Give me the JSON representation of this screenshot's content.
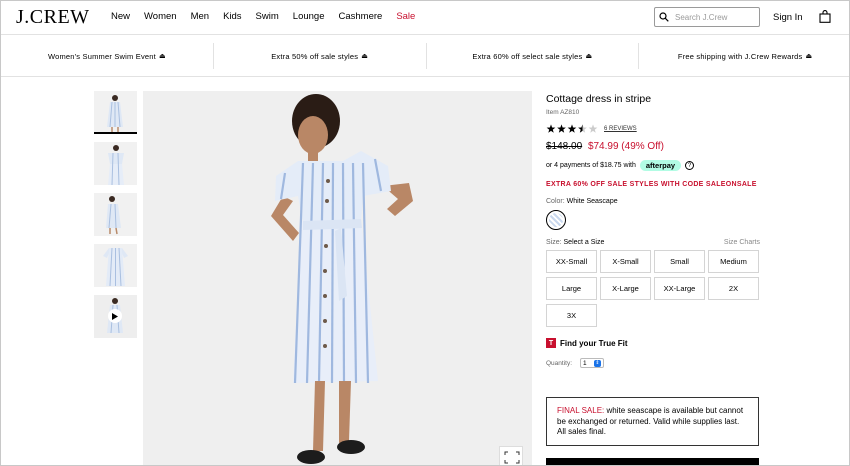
{
  "header": {
    "logo": "J.CREW",
    "nav": [
      "New",
      "Women",
      "Men",
      "Kids",
      "Swim",
      "Lounge",
      "Cashmere",
      "Sale"
    ],
    "search_placeholder": "Search J.Crew",
    "sign_in": "Sign In"
  },
  "promos": [
    "Women's Summer Swim Event",
    "Extra 50% off sale styles",
    "Extra 60% off select sale styles",
    "Free shipping with J.Crew Rewards"
  ],
  "product": {
    "title": "Cottage dress in stripe",
    "item": "Item AZ810",
    "rating": 3.5,
    "reviews": "6 REVIEWS",
    "was_price": "$148.00",
    "now_price": "$74.99 (49% Off)",
    "afterpay_text": "or 4 payments of $18.75 with",
    "afterpay_badge": "afterpay",
    "extra_promo": "EXTRA 60% OFF SALE STYLES WITH CODE SALEONSALE",
    "color_label": "Color:",
    "color_value": "White Seascape",
    "size_label": "Size:",
    "size_value": "Select a Size",
    "size_charts": "Size Charts",
    "sizes": [
      "XX-Small",
      "X-Small",
      "Small",
      "Medium",
      "Large",
      "X-Large",
      "XX-Large",
      "2X",
      "3X"
    ],
    "fit_text": "Find your True Fit",
    "quantity_label": "Quantity:",
    "quantity_value": "1",
    "final_sale_label": "FINAL SALE:",
    "final_sale_text": "white seascape is available but cannot be exchanged or returned. Valid while supplies last. All sales final."
  },
  "colors": {
    "sale_red": "#c8102e",
    "afterpay_mint": "#b2fce4"
  }
}
